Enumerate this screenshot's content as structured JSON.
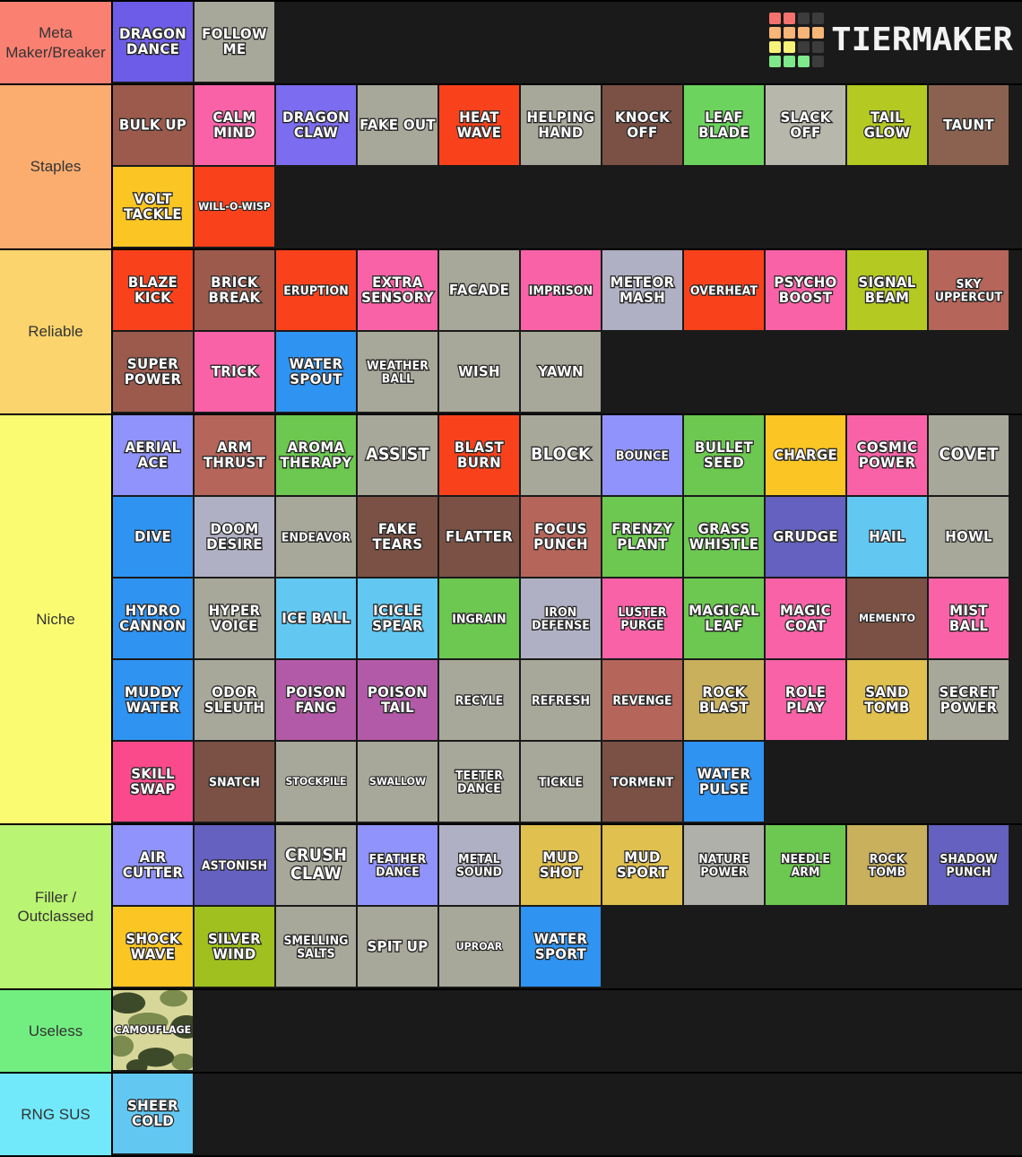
{
  "logo": {
    "name": "TierMaker",
    "text": "TIERMAKER",
    "grid_colors": [
      "#f4726e",
      "#f4726e",
      "#3c3c3c",
      "#3c3c3c",
      "#f7b578",
      "#f7b578",
      "#f7b578",
      "#f7b578",
      "#f7f278",
      "#f7f278",
      "#3c3c3c",
      "#3c3c3c",
      "#7ee88a",
      "#7ee88a",
      "#7ee88a",
      "#3c3c3c"
    ]
  },
  "tiers": [
    {
      "label": "Meta Maker/Breaker",
      "color": "#fa8072",
      "items": [
        {
          "text": "DRAGON DANCE",
          "color": "#6c5ce7",
          "size": "n"
        },
        {
          "text": "FOLLOW ME",
          "color": "#a8a89a",
          "size": "n"
        }
      ]
    },
    {
      "label": "Staples",
      "color": "#fbad70",
      "items": [
        {
          "text": "BULK UP",
          "color": "#a85murky",
          "size": "n"
        },
        {
          "text": "CALM MIND",
          "color": "#fa62a8",
          "size": "n"
        },
        {
          "text": "DRAGON CLAW",
          "color": "#7c6cf0",
          "size": "n"
        },
        {
          "text": "FAKE OUT",
          "color": "#a8a89a",
          "size": "n"
        },
        {
          "text": "HEAT WAVE",
          "color": "#f9421c",
          "size": "n"
        },
        {
          "text": "HELPING HAND",
          "color": "#a8a89a",
          "size": "n"
        },
        {
          "text": "KNOCK OFF",
          "color": "#7a5144",
          "size": "n"
        },
        {
          "text": "LEAF BLADE",
          "color": "#6cd martin",
          "size": "n"
        },
        {
          "text": "SLACK OFF",
          "color": "#b7b7ab",
          "size": "n"
        },
        {
          "text": "TAIL GLOW",
          "color": "#b4ca22",
          "size": "n"
        },
        {
          "text": "TAUNT",
          "color": "#8b6250",
          "size": "n"
        },
        {
          "text": "VOLT TACKLE",
          "color": "#fbc624",
          "size": "n"
        },
        {
          "text": "WILL-O-WISP",
          "color": "#f9421c",
          "size": "xs"
        }
      ]
    },
    {
      "label": "Reliable",
      "color": "#fbd46d",
      "items": [
        {
          "text": "BLAZE KICK",
          "color": "#f9421c",
          "size": "n"
        },
        {
          "text": "BRICK BREAK",
          "color": "#9c5a4c",
          "size": "n"
        },
        {
          "text": "ERUPTION",
          "color": "#f9421c",
          "size": "sm"
        },
        {
          "text": "EXTRA SENSORY",
          "color": "#fa62a8",
          "size": "n"
        },
        {
          "text": "FACADE",
          "color": "#a8a89a",
          "size": "n"
        },
        {
          "text": "IMPRISON",
          "color": "#fa62a8",
          "size": "sm"
        },
        {
          "text": "METEOR MASH",
          "color": "#b0b0c4",
          "size": "n"
        },
        {
          "text": "OVERHEAT",
          "color": "#f9421c",
          "size": "sm"
        },
        {
          "text": "PSYCHO BOOST",
          "color": "#fa62a8",
          "size": "n"
        },
        {
          "text": "SIGNAL BEAM",
          "color": "#b4ca22",
          "size": "n"
        },
        {
          "text": "SKY UPPERCUT",
          "color": "#b5655a",
          "size": "sm"
        },
        {
          "text": "SUPER POWER",
          "color": "#9c5a4c",
          "size": "n"
        },
        {
          "text": "TRICK",
          "color": "#fa62a8",
          "size": "n"
        },
        {
          "text": "WATER SPOUT",
          "color": "#2f93f2",
          "size": "n"
        },
        {
          "text": "WEATHER BALL",
          "color": "#a8a89a",
          "size": "sm"
        },
        {
          "text": "WISH",
          "color": "#a8a89a",
          "size": "n"
        },
        {
          "text": "YAWN",
          "color": "#a8a89a",
          "size": "n"
        }
      ]
    },
    {
      "label": "Niche",
      "color": "#fbfb72",
      "items": [
        {
          "text": "AERIAL ACE",
          "color": "#8f93fb",
          "size": "n"
        },
        {
          "text": "ARM THRUST",
          "color": "#b5655a",
          "size": "n"
        },
        {
          "text": "AROMA THERAPY",
          "color": "#6cc850",
          "size": "n"
        },
        {
          "text": "ASSIST",
          "color": "#a8a89a",
          "size": "lg"
        },
        {
          "text": "BLAST BURN",
          "color": "#f9421c",
          "size": "n"
        },
        {
          "text": "BLOCK",
          "color": "#a8a89a",
          "size": "lg"
        },
        {
          "text": "BOUNCE",
          "color": "#8f93fb",
          "size": "sm"
        },
        {
          "text": "BULLET SEED",
          "color": "#6cc850",
          "size": "n"
        },
        {
          "text": "CHARGE",
          "color": "#fbc624",
          "size": "n"
        },
        {
          "text": "COSMIC POWER",
          "color": "#fa62a8",
          "size": "n"
        },
        {
          "text": "COVET",
          "color": "#a8a89a",
          "size": "lg"
        },
        {
          "text": "DIVE",
          "color": "#2f93f2",
          "size": "n"
        },
        {
          "text": "DOOM DESIRE",
          "color": "#b0b0c4",
          "size": "n"
        },
        {
          "text": "ENDEAVOR",
          "color": "#a8a89a",
          "size": "sm"
        },
        {
          "text": "FAKE TEARS",
          "color": "#7a5144",
          "size": "n"
        },
        {
          "text": "FLATTER",
          "color": "#7a5144",
          "size": "n"
        },
        {
          "text": "FOCUS PUNCH",
          "color": "#b5655a",
          "size": "n"
        },
        {
          "text": "FRENZY PLANT",
          "color": "#6cc850",
          "size": "n"
        },
        {
          "text": "GRASS WHISTLE",
          "color": "#6cc850",
          "size": "n"
        },
        {
          "text": "GRUDGE",
          "color": "#6461c0",
          "size": "n"
        },
        {
          "text": "HAIL",
          "color": "#62c8f2",
          "size": "n"
        },
        {
          "text": "HOWL",
          "color": "#a8a89a",
          "size": "n"
        },
        {
          "text": "HYDRO CANNON",
          "color": "#2f93f2",
          "size": "n"
        },
        {
          "text": "HYPER VOICE",
          "color": "#a8a89a",
          "size": "n"
        },
        {
          "text": "ICE BALL",
          "color": "#62c8f2",
          "size": "n"
        },
        {
          "text": "ICICLE SPEAR",
          "color": "#62c8f2",
          "size": "n"
        },
        {
          "text": "INGRAIN",
          "color": "#6cc850",
          "size": "sm"
        },
        {
          "text": "IRON DEFENSE",
          "color": "#b0b0c4",
          "size": "sm"
        },
        {
          "text": "LUSTER PURGE",
          "color": "#fa62a8",
          "size": "sm"
        },
        {
          "text": "MAGICAL LEAF",
          "color": "#6cc850",
          "size": "n"
        },
        {
          "text": "MAGIC COAT",
          "color": "#fa62a8",
          "size": "n"
        },
        {
          "text": "MEMENTO",
          "color": "#7a5144",
          "size": "xs"
        },
        {
          "text": "MIST BALL",
          "color": "#fa62a8",
          "size": "n"
        },
        {
          "text": "MUDDY WATER",
          "color": "#2f93f2",
          "size": "n"
        },
        {
          "text": "ODOR SLEUTH",
          "color": "#a8a89a",
          "size": "n"
        },
        {
          "text": "POISON FANG",
          "color": "#b25aa8",
          "size": "n"
        },
        {
          "text": "POISON TAIL",
          "color": "#b25aa8",
          "size": "n"
        },
        {
          "text": "RECYLE",
          "color": "#a8a89a",
          "size": "sm"
        },
        {
          "text": "REFRESH",
          "color": "#a8a89a",
          "size": "sm"
        },
        {
          "text": "REVENGE",
          "color": "#b5655a",
          "size": "sm"
        },
        {
          "text": "ROCK BLAST",
          "color": "#c9b05c",
          "size": "n"
        },
        {
          "text": "ROLE PLAY",
          "color": "#fa62a8",
          "size": "n"
        },
        {
          "text": "SAND TOMB",
          "color": "#e0c04e",
          "size": "n"
        },
        {
          "text": "SECRET POWER",
          "color": "#a8a89a",
          "size": "n"
        },
        {
          "text": "SKILL SWAP",
          "color": "#fa4a8c",
          "size": "n"
        },
        {
          "text": "SNATCH",
          "color": "#7a5144",
          "size": "sm"
        },
        {
          "text": "STOCKPILE",
          "color": "#a8a89a",
          "size": "xs"
        },
        {
          "text": "SWALLOW",
          "color": "#a8a89a",
          "size": "xs"
        },
        {
          "text": "TEETER DANCE",
          "color": "#a8a89a",
          "size": "sm"
        },
        {
          "text": "TICKLE",
          "color": "#a8a89a",
          "size": "sm"
        },
        {
          "text": "TORMENT",
          "color": "#7a5144",
          "size": "sm"
        },
        {
          "text": "WATER PULSE",
          "color": "#2f93f2",
          "size": "n"
        }
      ]
    },
    {
      "label": "Filler / Outclassed",
      "color": "#b9f472",
      "items": [
        {
          "text": "AIR CUTTER",
          "color": "#8f93fb",
          "size": "n"
        },
        {
          "text": "ASTONISH",
          "color": "#6461c0",
          "size": "sm"
        },
        {
          "text": "CRUSH CLAW",
          "color": "#a8a89a",
          "size": "lg"
        },
        {
          "text": "FEATHER DANCE",
          "color": "#8f93fb",
          "size": "sm"
        },
        {
          "text": "METAL SOUND",
          "color": "#b0b0c4",
          "size": "sm"
        },
        {
          "text": "MUD SHOT",
          "color": "#e0c04e",
          "size": "n"
        },
        {
          "text": "MUD SPORT",
          "color": "#e0c04e",
          "size": "n"
        },
        {
          "text": "NATURE POWER",
          "color": "#b0b0ab",
          "size": "sm"
        },
        {
          "text": "NEEDLE ARM",
          "color": "#6cc850",
          "size": "sm"
        },
        {
          "text": "ROCK TOMB",
          "color": "#c9b05c",
          "size": "sm"
        },
        {
          "text": "SHADOW PUNCH",
          "color": "#6461c0",
          "size": "sm"
        },
        {
          "text": "SHOCK WAVE",
          "color": "#fbc624",
          "size": "n"
        },
        {
          "text": "SILVER WIND",
          "color": "#9fc01e",
          "size": "n"
        },
        {
          "text": "SMELLING SALTS",
          "color": "#a8a89a",
          "size": "sm"
        },
        {
          "text": "SPIT UP",
          "color": "#a8a89a",
          "size": "n"
        },
        {
          "text": "UPROAR",
          "color": "#a8a89a",
          "size": "xs"
        },
        {
          "text": "WATER SPORT",
          "color": "#2f93f2",
          "size": "n"
        }
      ]
    },
    {
      "label": "Useless",
      "color": "#72ee80",
      "items": [
        {
          "text": "CAMOUFLAGE",
          "color": "camo",
          "size": "xs"
        }
      ]
    },
    {
      "label": "RNG SUS",
      "color": "#72e8fb",
      "items": [
        {
          "text": "SHEER COLD",
          "color": "#62c8f2",
          "size": "n"
        }
      ]
    }
  ]
}
